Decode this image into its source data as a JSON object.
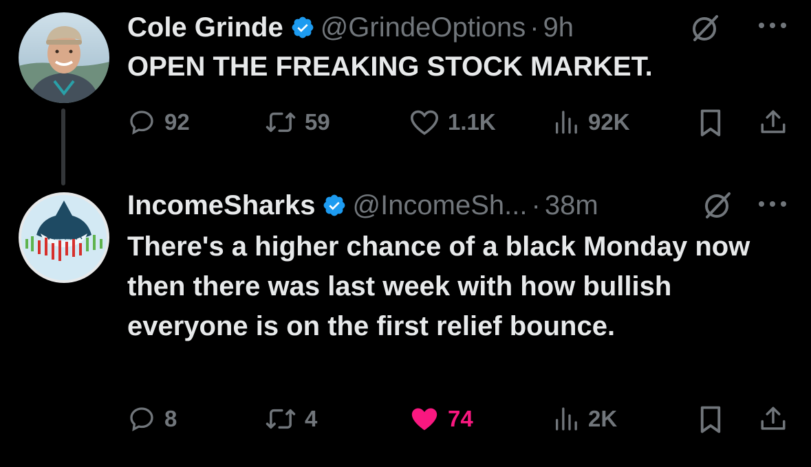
{
  "tweets": [
    {
      "author": "Cole Grinde",
      "handle": "@GrindeOptions",
      "time": "9h",
      "text": "OPEN THE FREAKING STOCK MARKET.",
      "replies": "92",
      "reposts": "59",
      "likes": "1.1K",
      "views": "92K",
      "liked": false
    },
    {
      "author": "IncomeSharks",
      "handle": "@IncomeSh...",
      "time": "38m",
      "text": "There's a higher chance of a black Monday now then there was last week with how bullish everyone is on the first relief bounce.",
      "replies": "8",
      "reposts": "4",
      "likes": "74",
      "views": "2K",
      "liked": true
    }
  ],
  "colors": {
    "background": "#000000",
    "text": "#e7e9ea",
    "muted": "#71767b",
    "verified": "#1d9bf0",
    "like": "#f91880"
  },
  "icons": [
    "verified-badge-icon",
    "grok-icon",
    "more-icon",
    "reply-icon",
    "repost-icon",
    "like-icon",
    "views-icon",
    "bookmark-icon",
    "share-icon"
  ]
}
